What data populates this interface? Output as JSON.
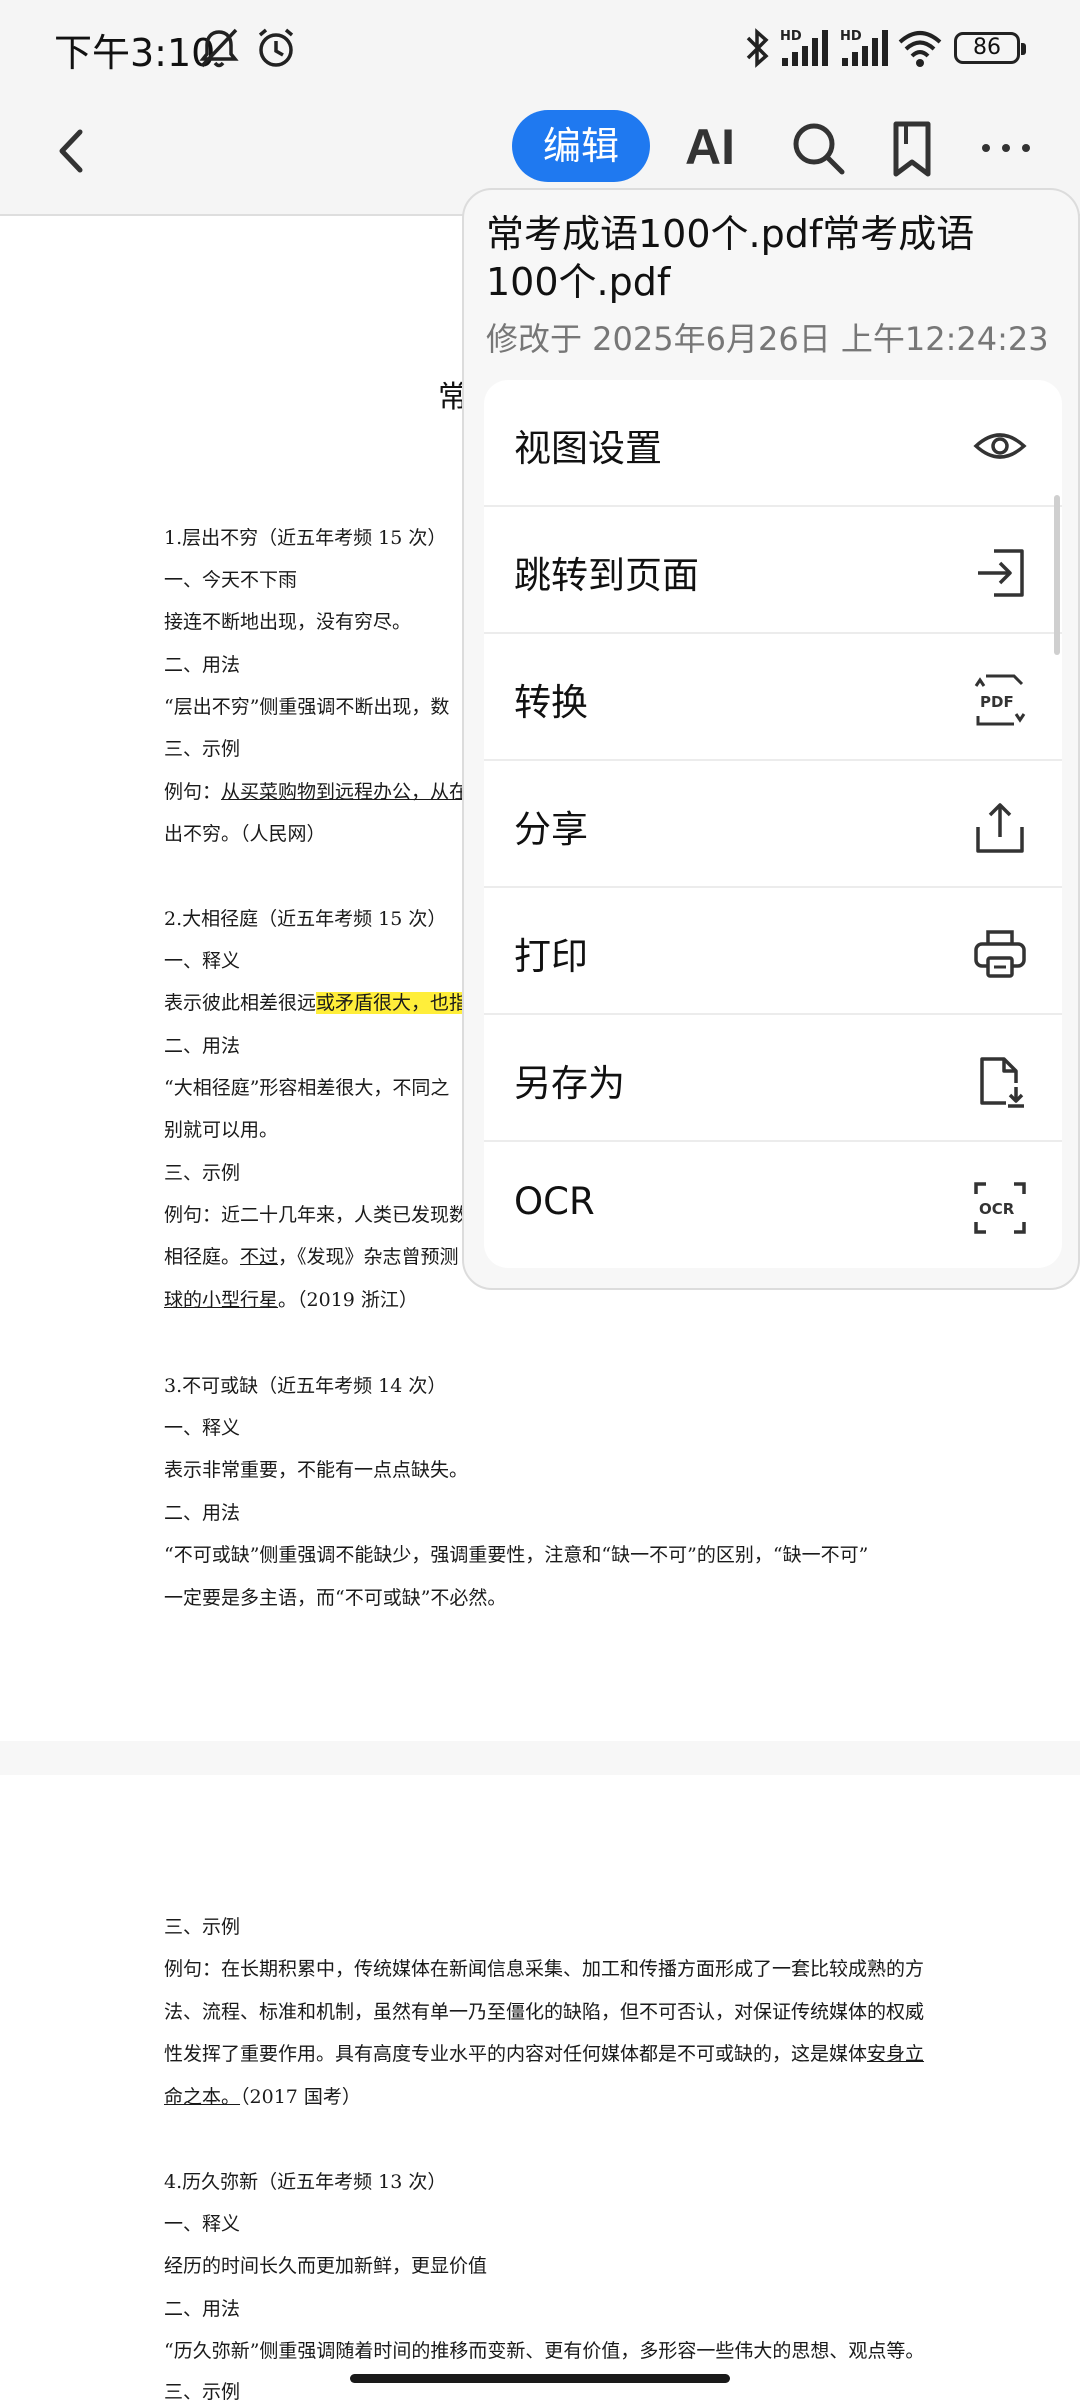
{
  "status_bar": {
    "time": "下午3:10",
    "battery": "86"
  },
  "toolbar": {
    "edit_label": "编辑",
    "ai_label": "AI"
  },
  "menu": {
    "title": "常考成语100个.pdf常考成语100个.pdf",
    "subtitle": "修改于 2025年6月26日 上午12:24:23",
    "items": [
      {
        "label": "视图设置",
        "icon": "eye-icon"
      },
      {
        "label": "跳转到页面",
        "icon": "jump-to-page-icon"
      },
      {
        "label": "转换",
        "icon": "pdf-convert-icon"
      },
      {
        "label": "分享",
        "icon": "share-icon"
      },
      {
        "label": "打印",
        "icon": "printer-icon"
      },
      {
        "label": "另存为",
        "icon": "save-as-icon"
      },
      {
        "label": "OCR",
        "icon": "ocr-icon"
      }
    ]
  },
  "doc": {
    "title_visible": "常",
    "lines": [
      "1.层出不穷（近五年考频 15 次）",
      "一、今天不下雨",
      "接连不断地出现，没有穷尽。",
      "二、用法",
      "“层出不穷”侧重强调不断出现，数",
      "三、示例",
      "例句：",
      "从买菜购物到远程办公，从在",
      "出不穷。（人民网）",
      "2.大相径庭（近五年考频 15 次）",
      "一、释义",
      "表示彼此相差很远",
      "或矛盾很大，也指",
      "二、用法",
      "“大相径庭”形容相差很大，不同之",
      "别就可以用。",
      "三、示例",
      "例句：近二十几年来，人类已发现数",
      "相径庭。",
      "不过",
      "，《发现》杂志曾预测",
      "球的小型行星",
      "。（2019 浙江）",
      "3.不可或缺（近五年考频 14 次）",
      "一、释义",
      "表示非常重要，不能有一点点缺失。",
      "二、用法",
      "“不可或缺”侧重强调不能缺少，强调重要性，注意和“缺一不可”的区别，“缺一不可”",
      "一定要是多主语，而“不可或缺”不必然。",
      "三、示例",
      "例句：在长期积累中，传统媒体在新闻信息采集、加工和传播方面形成了一套比较成熟的方",
      "法、流程、标准和机制，虽然有单一乃至僵化的缺陷，但不可否认，对保证传统媒体的权威",
      "性发挥了重要作用。具有高度专业水平的内容对任何媒体都是不可或缺的，这是媒体",
      "安身立",
      "命之本。",
      "（2017 国考）",
      "4.历久弥新（近五年考频 13 次）",
      "一、释义",
      "经历的时间长久而更加新鲜，更显价值",
      "二、用法",
      "“历久弥新”侧重强调随着时间的推移而变新、更有价值，多形容一些伟大的思想、观点等。",
      "三、示例"
    ]
  }
}
